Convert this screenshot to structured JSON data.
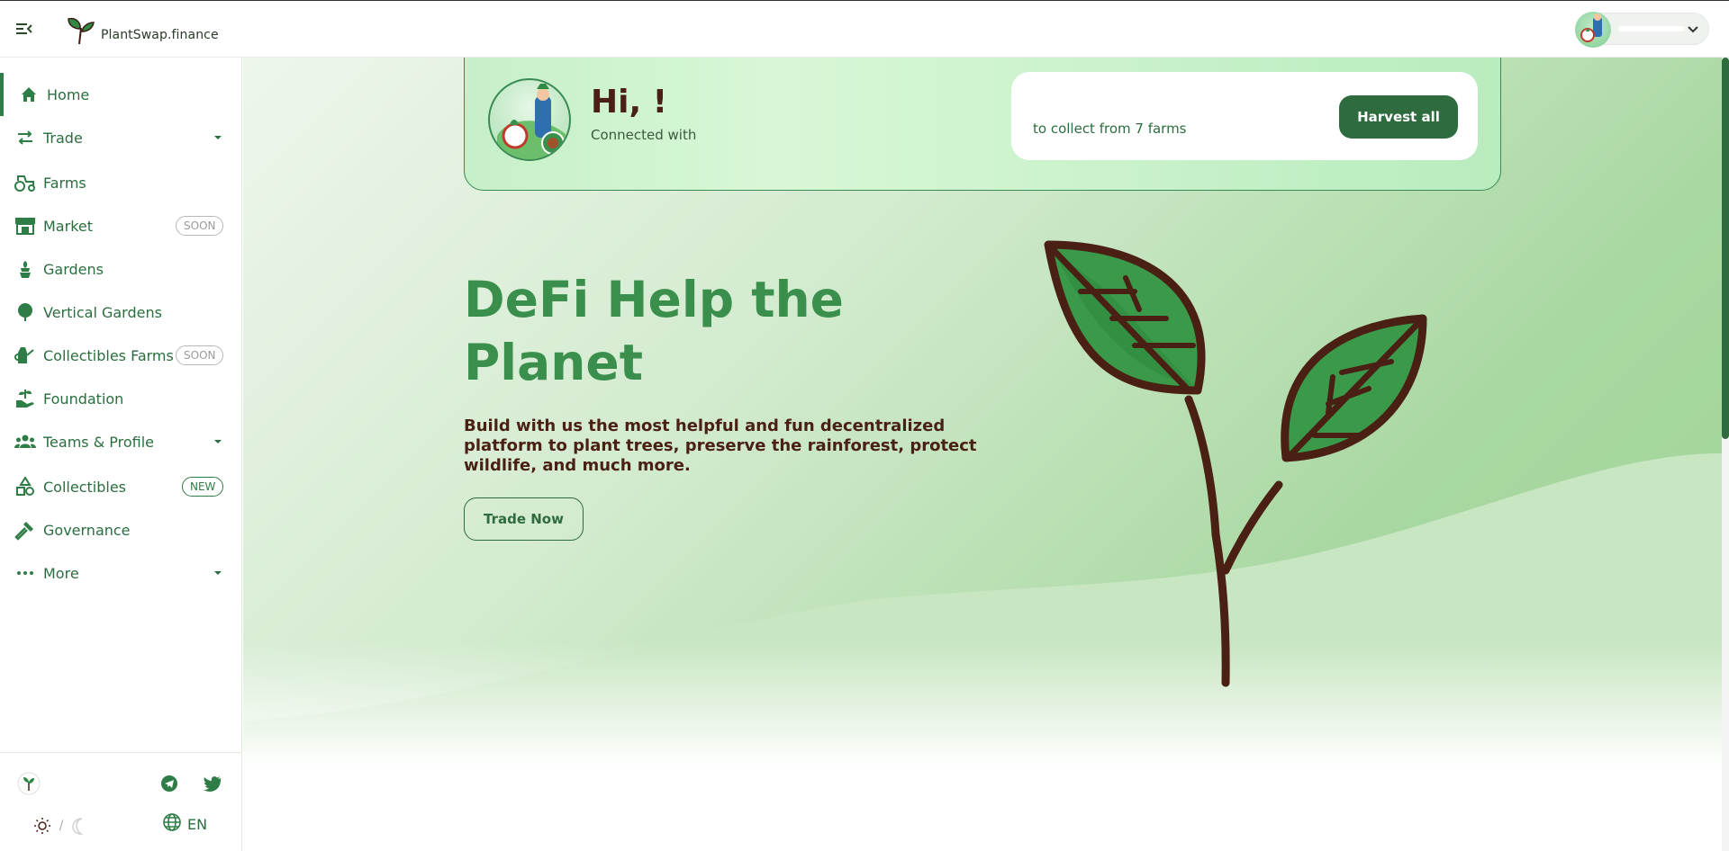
{
  "header": {
    "brand": "PlantSwap.finance",
    "icons": {
      "menu": "menu-collapse-icon",
      "logo": "plant-sprout-logo",
      "chevron": "chevron-down-icon"
    }
  },
  "sidebar": {
    "items": [
      {
        "label": "Home",
        "icon": "home-icon",
        "active": true
      },
      {
        "label": "Trade",
        "icon": "swap-arrows-icon",
        "has_submenu": true
      },
      {
        "label": "Farms",
        "icon": "tractor-icon"
      },
      {
        "label": "Market",
        "icon": "market-stall-icon",
        "badge": "SOON"
      },
      {
        "label": "Gardens",
        "icon": "potted-plant-icon"
      },
      {
        "label": "Vertical Gardens",
        "icon": "tree-icon"
      },
      {
        "label": "Collectibles Farms",
        "icon": "watering-can-icon",
        "badge": "SOON"
      },
      {
        "label": "Foundation",
        "icon": "hand-sprout-icon"
      },
      {
        "label": "Teams & Profile",
        "icon": "team-icon",
        "has_submenu": true
      },
      {
        "label": "Collectibles",
        "icon": "shapes-icon",
        "badge": "NEW"
      },
      {
        "label": "Governance",
        "icon": "gavel-icon"
      },
      {
        "label": "More",
        "icon": "more-dots-icon",
        "has_submenu": true
      }
    ],
    "footer": {
      "language": "EN",
      "theme_separator": "/",
      "icons": [
        "plant-token-icon",
        "telegram-icon",
        "twitter-icon",
        "sun-icon",
        "moon-icon",
        "globe-icon"
      ]
    }
  },
  "main": {
    "greeting": {
      "title": "Hi, !",
      "subtitle": "Connected with",
      "harvest_text": "to collect from 7 farms",
      "harvest_button": "Harvest all"
    },
    "hero": {
      "title_line1": "DeFi Help the",
      "title_line2": "Planet",
      "subtitle": "Build with us the most helpful and fun decentralized platform to plant trees, preserve the rainforest, protect wildlife, and much more.",
      "cta": "Trade Now"
    }
  },
  "colors": {
    "brand_green": "#2e6b3e",
    "hero_title_green": "#3a8f4c",
    "text_brown": "#4a1f14",
    "nav_text": "#2a6e3f"
  }
}
